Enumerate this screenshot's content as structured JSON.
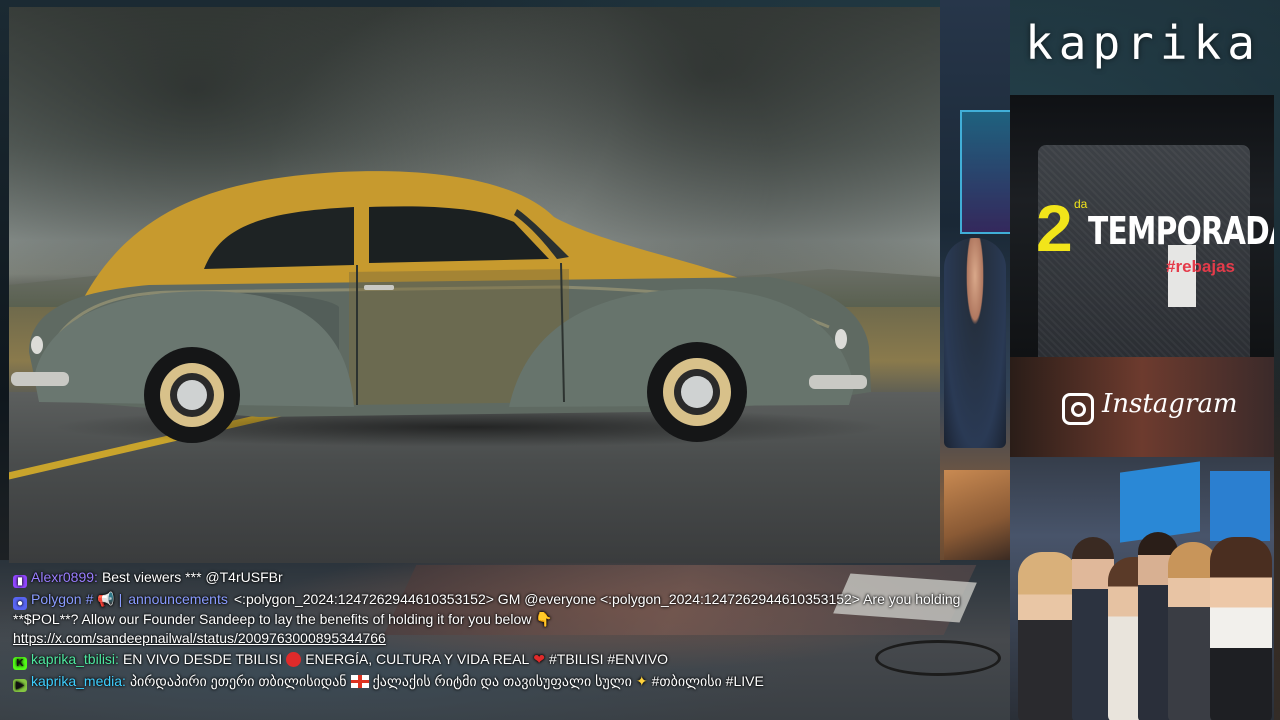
{
  "brand": {
    "logo": "kaprika"
  },
  "ads": {
    "season": {
      "number": "2",
      "superscript": "da",
      "word": "TEMPORADA!",
      "hashtag": "#rebajas"
    },
    "instagram": {
      "label": "Instagram",
      "icon": "instagram-icon"
    }
  },
  "video": {
    "scene": "vintage-car-on-road"
  },
  "chat": [
    {
      "platform": "twitch-icon",
      "user": "Alexr0899:",
      "text": "Best viewers *** @T4rUSFBr"
    },
    {
      "platform": "discord-icon",
      "user": "Polygon",
      "channel_prefix": "# 📢 |",
      "channel": "announcements",
      "text": "<:polygon_2024:1247262944610353152> GM @everyone <:polygon_2024:1247262944610353152> Are you holding **$POL**? Allow our Founder Sandeep to lay the benefits of holding it for you below",
      "emoji": "👇",
      "link": "https://x.com/sandeepnailwal/status/2009763000895344766"
    },
    {
      "platform": "kick-icon",
      "user": "kaprika_tbilisi:",
      "text_a": "EN VIVO DESDE TBILISI",
      "text_b": "ENERGÍA, CULTURA Y VIDA REAL",
      "text_c": "#TBILISI #ENVIVO"
    },
    {
      "platform": "rumble-icon",
      "user": "kaprika_media:",
      "text_a": "პირდაპირი ეთერი თბილისიდან",
      "text_b": "ქალაქის რიტმი და თავისუფალი სული",
      "text_c": "#თბილისი #LIVE"
    }
  ],
  "colors": {
    "kick": "#53fc18",
    "twitch": "#9146ff",
    "discord": "#5865f2",
    "ad_yellow": "#f2e51a",
    "ad_red": "#e53b4a"
  }
}
